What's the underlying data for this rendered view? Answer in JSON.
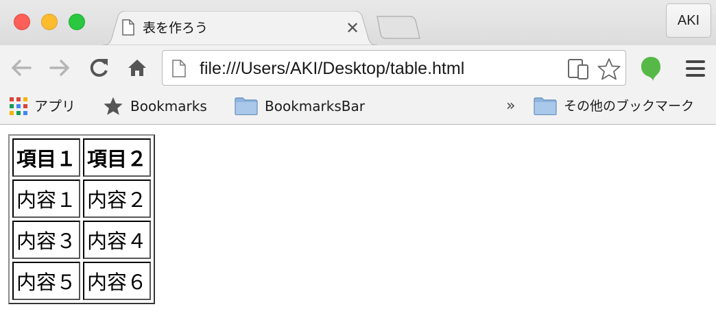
{
  "window": {
    "controls": [
      "close",
      "minimize",
      "zoom"
    ],
    "profile_label": "AKI"
  },
  "tab": {
    "title": "表を作ろう",
    "close_glyph": "✕",
    "icon": "page-icon"
  },
  "toolbar": {
    "url": "file:///Users/AKI/Desktop/table.html",
    "icons": [
      "back-arrow-icon",
      "forward-arrow-icon",
      "reload-icon",
      "home-icon",
      "page-icon",
      "devices-icon",
      "star-icon",
      "evernote-icon",
      "menu-icon"
    ]
  },
  "bookmarks": {
    "apps_label": "アプリ",
    "items": [
      {
        "label": "Bookmarks",
        "icon": "star-icon"
      },
      {
        "label": "BookmarksBar",
        "icon": "folder-icon"
      }
    ],
    "overflow_glyph": "»",
    "other_label": "その他のブックマーク"
  },
  "table": {
    "headers": [
      "項目１",
      "項目２"
    ],
    "rows": [
      [
        "内容１",
        "内容２"
      ],
      [
        "内容３",
        "内容４"
      ],
      [
        "内容５",
        "内容６"
      ]
    ]
  },
  "colors": {
    "close": "#fc5f57",
    "minimize": "#fdbc2e",
    "zoom": "#29c840",
    "evernote": "#56b947"
  }
}
